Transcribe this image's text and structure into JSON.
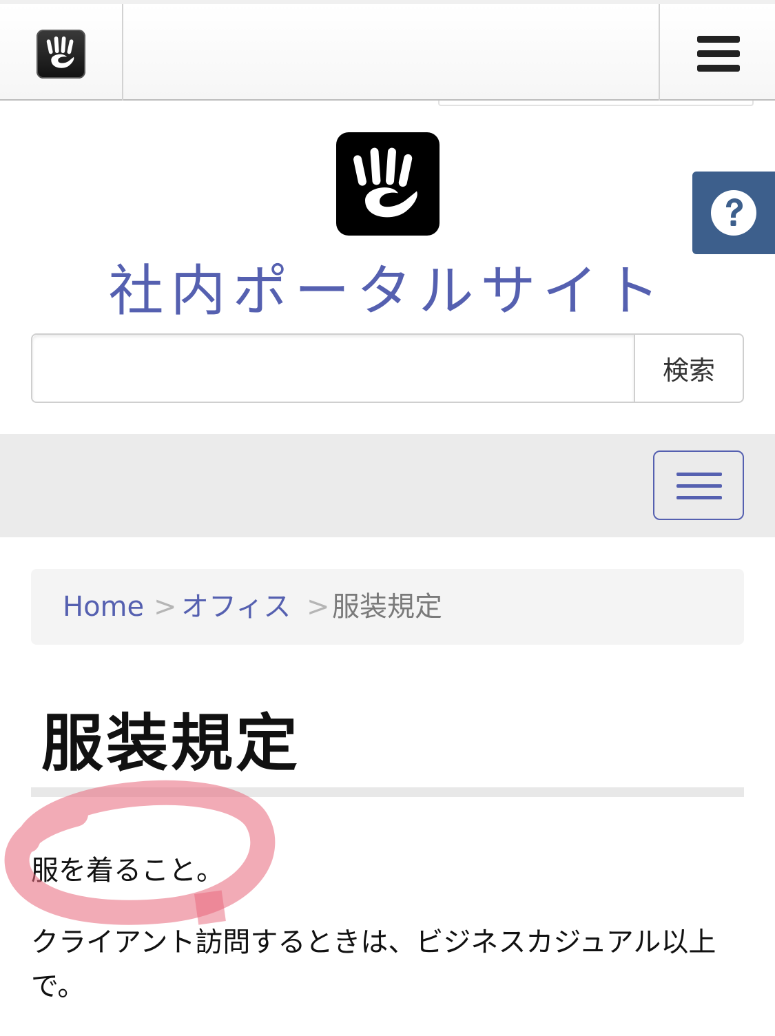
{
  "toolbar": {
    "logo_icon": "concrete5-hand-icon",
    "menu_icon": "hamburger-icon"
  },
  "help": {
    "icon": "question-circle-icon",
    "color": "#3d5f8c"
  },
  "header": {
    "logo_icon": "concrete5-hand-icon",
    "site_title": "社内ポータルサイト",
    "title_color": "#5560b0"
  },
  "search": {
    "value": "",
    "placeholder": "",
    "button_label": "検索"
  },
  "nav": {
    "toggle_icon": "hamburger-icon"
  },
  "breadcrumb": {
    "home": "Home",
    "sep1": ">",
    "office": "オフィス",
    "sep2": ">",
    "current": "服装規定"
  },
  "content": {
    "title": "服装規定",
    "paragraph1": "服を着ること。",
    "paragraph2": "クライアント訪問するときは、ビジネスカジュアル以上で。"
  },
  "annotation": {
    "color": "#e8667a"
  }
}
